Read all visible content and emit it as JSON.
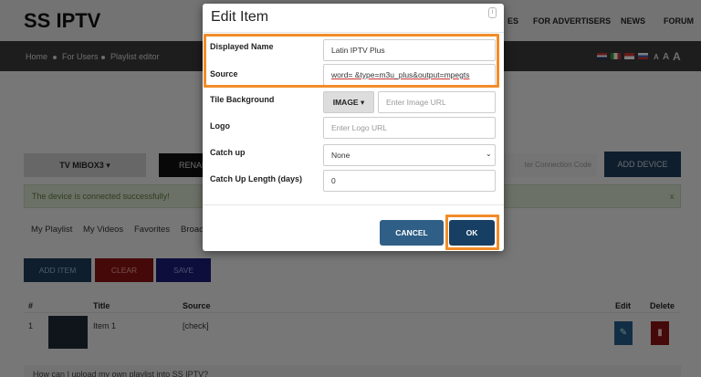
{
  "site": {
    "logo": "SS IPTV",
    "nav": [
      "ES",
      "FOR ADVERTISERS",
      "NEWS",
      "FORUM"
    ],
    "breadcrumb": [
      "Home",
      "For Users",
      "Playlist editor"
    ],
    "font_sizes": [
      "A",
      "A",
      "A"
    ]
  },
  "devices": {
    "selected": "TV MIBOX3",
    "rename_label": "RENAME",
    "connection_code_placeholder": "ter Connection Code",
    "add_device_label": "ADD DEVICE",
    "alert_text": "The device is connected successfully!",
    "alert_close": "x"
  },
  "playlist_tabs": [
    "My Playlist",
    "My Videos",
    "Favorites",
    "Broad"
  ],
  "actions": {
    "add_item": "ADD ITEM",
    "clear": "CLEAR",
    "save": "SAVE"
  },
  "table": {
    "headers": {
      "num": "#",
      "title": "Title",
      "source": "Source",
      "edit": "Edit",
      "delete": "Delete"
    },
    "rows": [
      {
        "num": "1",
        "title": "Item 1",
        "source": "[check]"
      }
    ]
  },
  "faq_text": "How can I upload my own playlist into SS IPTV?",
  "modal": {
    "title": "Edit Item",
    "displayed_name_label": "Displayed Name",
    "displayed_name_value": "Latin IPTV Plus",
    "source_label": "Source",
    "source_value": "word=            &type=m3u_plus&output=mpegts",
    "tile_background_label": "Tile Background",
    "tile_background_mode": "IMAGE",
    "image_url_placeholder": "Enter Image URL",
    "logo_label": "Logo",
    "logo_placeholder": "Enter Logo URL",
    "catch_up_label": "Catch up",
    "catch_up_value": "None",
    "catch_up_length_label": "Catch Up Length (days)",
    "catch_up_length_value": "0",
    "cancel_label": "CANCEL",
    "ok_label": "OK"
  },
  "colors": {
    "highlight": "#f28c28",
    "primary_button": "#163f63",
    "secondary_button": "#2f5f86",
    "header_bar": "#3a3a3a"
  }
}
